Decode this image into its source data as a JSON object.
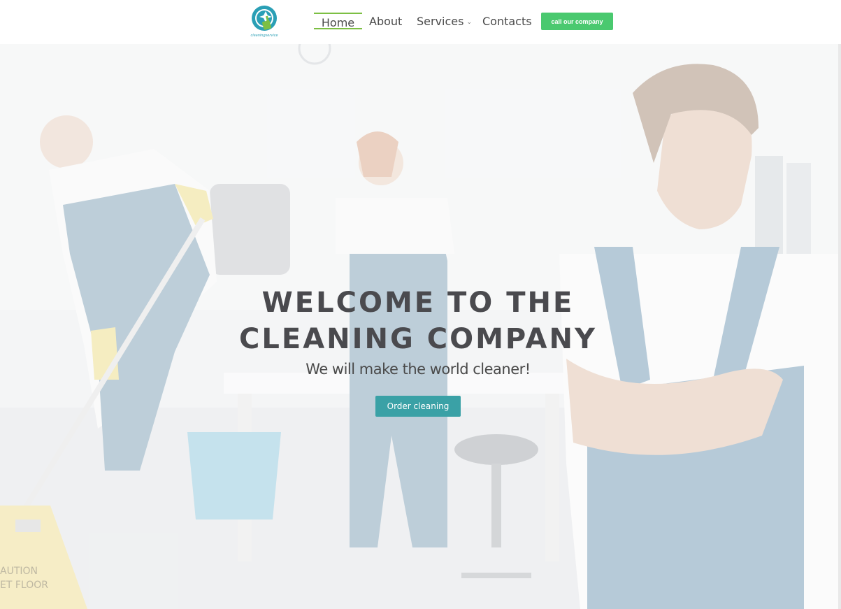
{
  "brand": {
    "logo_text": "cleaningservice",
    "colors": {
      "teal": "#2a9fb5",
      "green": "#4ac96f",
      "nav_underline": "#7cbf43",
      "button_teal": "#3aa1a6"
    }
  },
  "nav": {
    "items": [
      {
        "label": "Home",
        "active": true
      },
      {
        "label": "About"
      },
      {
        "label": "Services",
        "icon": "chevron-down-icon"
      },
      {
        "label": "Contacts"
      }
    ],
    "cta_label": "call our company"
  },
  "hero": {
    "title_line1": "WELCOME TO THE",
    "title_line2": "CLEANING COMPANY",
    "subtitle": "We will make the world cleaner!",
    "button_label": "Order cleaning",
    "sign_text_1": "AUTION",
    "sign_text_2": "ET FLOOR"
  }
}
